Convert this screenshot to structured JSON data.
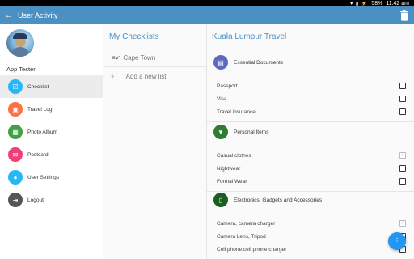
{
  "status_bar": {
    "battery": "58%",
    "time": "11:42 am"
  },
  "app_bar": {
    "title": "User Activity"
  },
  "drawer": {
    "username": "App Tester",
    "items": [
      {
        "label": "Checklist",
        "icon": "checklist-icon",
        "color": "#29b6f6",
        "active": true
      },
      {
        "label": "Travel Log",
        "icon": "travel-log-icon",
        "color": "#ff7043"
      },
      {
        "label": "Photo Album",
        "icon": "photo-album-icon",
        "color": "#43a047"
      },
      {
        "label": "Postcard",
        "icon": "postcard-icon",
        "color": "#ec407a"
      },
      {
        "label": "User Settings",
        "icon": "user-icon",
        "color": "#29b6f6"
      },
      {
        "label": "Logout",
        "icon": "logout-icon",
        "color": "#555555"
      }
    ]
  },
  "checklists": {
    "title": "My Checklists",
    "items": [
      "Cape Town"
    ],
    "add_label": "Add a new list"
  },
  "detail": {
    "title": "Kuala Lumpur Travel",
    "sections": [
      {
        "name": "Essential Documents",
        "icon": "document-icon",
        "color": "#5c6bc0",
        "items": [
          {
            "label": "Passport",
            "checked": false
          },
          {
            "label": "Visa",
            "checked": false
          },
          {
            "label": "Travel insurance",
            "checked": false
          }
        ]
      },
      {
        "name": "Personal Items",
        "icon": "shirt-icon",
        "color": "#2e7d32",
        "items": [
          {
            "label": "Casual clothes",
            "checked": true
          },
          {
            "label": "Nightwear",
            "checked": false
          },
          {
            "label": "Formal Wear",
            "checked": false
          }
        ]
      },
      {
        "name": "Electronics, Gadgets and Accessories",
        "icon": "phone-icon",
        "color": "#1b5e20",
        "items": [
          {
            "label": "Camera, camera charger",
            "checked": true
          },
          {
            "label": "Camera Lens, Tripod",
            "checked": false
          },
          {
            "label": "Cell phone,cell phone charger",
            "checked": false
          }
        ]
      }
    ]
  }
}
